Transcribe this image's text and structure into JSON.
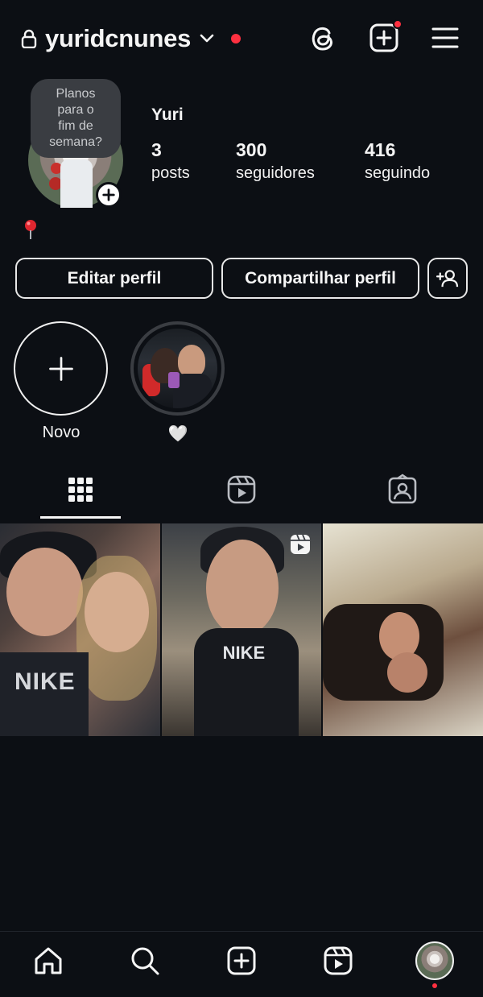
{
  "header": {
    "username": "yuridcnunes",
    "icons": [
      "lock-icon",
      "chevron-down-icon",
      "threads-icon",
      "create-post-icon",
      "menu-icon"
    ],
    "notification_dot_color": "#ff3040"
  },
  "profile": {
    "note": "Planos\npara o\nfim de\nsemana?",
    "display_name": "Yuri",
    "bio_emoji": "📍",
    "stats": [
      {
        "value": "3",
        "label": "posts"
      },
      {
        "value": "300",
        "label": "seguidores"
      },
      {
        "value": "416",
        "label": "seguindo"
      }
    ]
  },
  "actions": {
    "edit_label": "Editar perfil",
    "share_label": "Compartilhar perfil",
    "add_user_icon": "add-user-icon"
  },
  "highlights": [
    {
      "label": "Novo",
      "icon": "plus-icon"
    },
    {
      "label": "🤍"
    }
  ],
  "tabs": [
    {
      "name": "grid",
      "icon": "grid-icon",
      "active": true
    },
    {
      "name": "reels",
      "icon": "reels-icon",
      "active": false
    },
    {
      "name": "tagged",
      "icon": "tagged-icon",
      "active": false
    }
  ],
  "posts": [
    {
      "overlay_text": "NIKE"
    },
    {
      "overlay_text": "NIKE",
      "badge_icon": "reels-icon"
    },
    {}
  ],
  "bottom_nav": [
    "home-icon",
    "search-icon",
    "create-icon",
    "reels-icon",
    "profile-avatar"
  ],
  "colors": {
    "background": "#0c0f14",
    "text": "#f5f5f5",
    "accent_red": "#ff3040"
  }
}
